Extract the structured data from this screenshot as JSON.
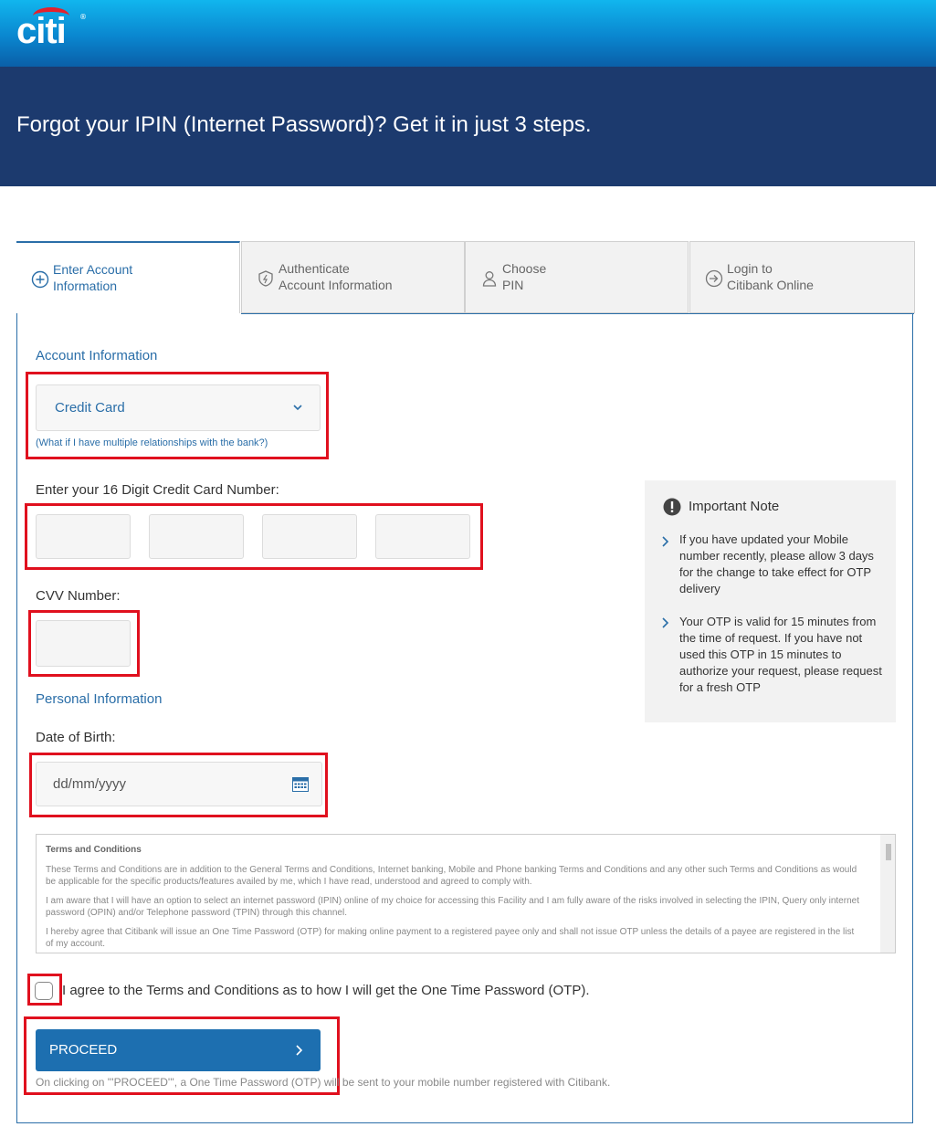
{
  "brand": {
    "logo_text": "citi",
    "reg_mark": "®"
  },
  "hero": {
    "title": "Forgot your IPIN (Internet Password)? Get it in just 3 steps."
  },
  "tabs": [
    {
      "label": "Enter Account\nInformation",
      "icon": "plus-circle-icon",
      "active": true
    },
    {
      "label": "Authenticate\nAccount Information",
      "icon": "shield-icon",
      "active": false
    },
    {
      "label": "Choose\nPIN",
      "icon": "user-icon",
      "active": false
    },
    {
      "label": "Login to\nCitibank Online",
      "icon": "login-icon",
      "active": false
    }
  ],
  "account": {
    "heading": "Account Information",
    "selected": "Credit Card",
    "help_link": "(What if I have multiple relationships with the bank?)"
  },
  "card_number": {
    "label": "Enter your 16 Digit Credit Card Number:"
  },
  "cvv": {
    "label": "CVV Number:"
  },
  "personal": {
    "heading": "Personal Information",
    "dob_label": "Date of Birth:",
    "dob_placeholder": "dd/mm/yyyy"
  },
  "note": {
    "title": "Important Note",
    "items": [
      "If you have updated your Mobile number recently, please allow 3 days for the change to take effect for OTP delivery",
      "Your OTP is valid for 15 minutes from the time of request. If you have not used this OTP in 15 minutes to authorize your request, please request for a fresh OTP"
    ]
  },
  "terms": {
    "title": "Terms and Conditions",
    "paragraphs": [
      "These Terms and Conditions are in addition to the General Terms and Conditions, Internet banking, Mobile and Phone banking Terms and Conditions and any other such Terms and Conditions as would be applicable for the specific products/features availed by me, which I have read, understood and agreed to comply with.",
      "I am aware that I will have an option to select an internet password (IPIN) online of my choice for accessing this Facility and I am fully aware of the risks involved in selecting the IPIN, Query only internet password (OPIN) and/or Telephone password (TPIN) through this channel.",
      "I hereby agree that Citibank will issue an One Time Password (OTP) for making online payment to a registered payee only and shall not issue OTP unless the details of a payee are registered in the list of my account."
    ]
  },
  "agree_text": "I agree to the Terms and Conditions as to how I will get the One Time Password (OTP).",
  "proceed": {
    "label": "PROCEED",
    "footnote": "On clicking on '''PROCEED''', a One Time Password (OTP) will be sent to your mobile number registered with Citibank."
  },
  "colors": {
    "accent": "#2a6ea8",
    "hero_bg": "#1c3a6e",
    "highlight": "#e0101e",
    "button": "#1d6fb0"
  }
}
